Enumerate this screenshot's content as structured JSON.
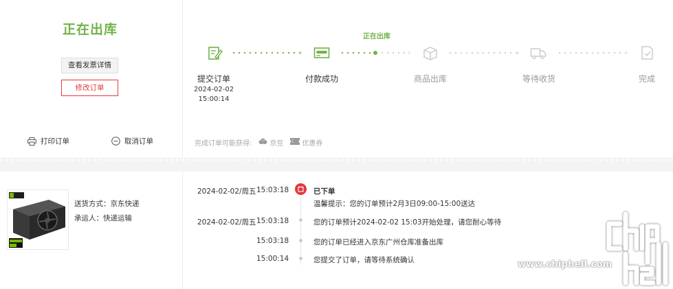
{
  "order": {
    "status_title": "正在出库",
    "invoice_button": "查看发票详情",
    "modify_button": "修改订单",
    "print_label": "打印订单",
    "cancel_label": "取消订单"
  },
  "progress": {
    "current_label": "正在出库",
    "steps": [
      {
        "label": "提交订单",
        "date": "2024-02-02",
        "time": "15:00:14",
        "state": "done",
        "icon": "edit-icon"
      },
      {
        "label": "付款成功",
        "state": "done",
        "icon": "card-icon"
      },
      {
        "label": "商品出库",
        "state": "pending",
        "icon": "box-icon"
      },
      {
        "label": "等待收货",
        "state": "pending",
        "icon": "truck-icon"
      },
      {
        "label": "完成",
        "state": "pending",
        "icon": "check-doc-icon"
      }
    ]
  },
  "benefits": {
    "label": "完成订单可能获得:",
    "items": [
      {
        "label": "京豆",
        "icon": "bean-icon"
      },
      {
        "label": "优惠券",
        "icon": "coupon-icon"
      }
    ]
  },
  "shipping": {
    "method": "送货方式：京东快递",
    "carrier": "承运人：快递运输",
    "product_image": "graphics-card-image"
  },
  "tracking": {
    "log": [
      {
        "date": "2024-02-02/周五",
        "time": "15:03:18",
        "title": "已下单",
        "message": "温馨提示：您的订单预计2月3日09:00-15:00送达"
      },
      {
        "date": "2024-02-02/周五",
        "time": "15:03:18",
        "message": "您的订单预计2024-02-02 15:03开始处理，请您耐心等待"
      },
      {
        "date": "",
        "time": "15:03:18",
        "message": "您的订单已经进入京东广州仓库准备出库"
      },
      {
        "date": "",
        "time": "15:00:14",
        "message": "您提交了订单，请等待系统确认"
      }
    ]
  },
  "watermark": {
    "site": "www.chiphell.com",
    "logo": "chip hell"
  },
  "colors": {
    "accent_green": "#71b247",
    "accent_red": "#e4393c",
    "muted": "#999999"
  }
}
